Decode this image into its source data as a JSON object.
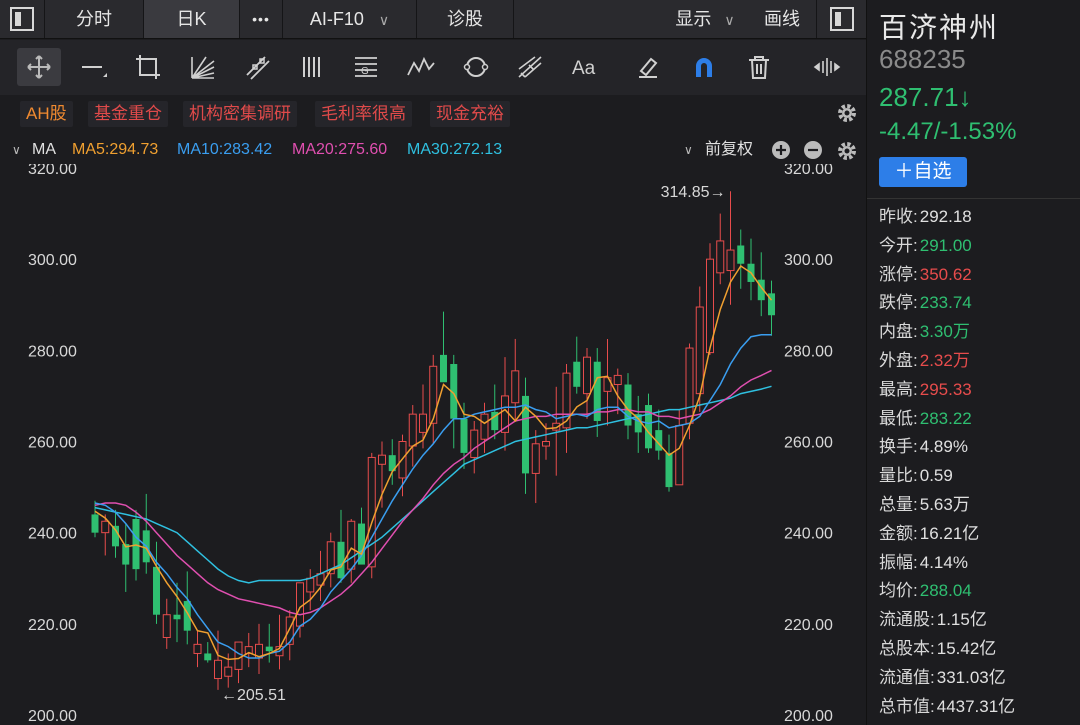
{
  "topbar": {
    "tab_intraday": "分时",
    "tab_daily": "日K",
    "more": "•••",
    "f10": "AI-F10",
    "diagnose": "诊股",
    "display": "显示",
    "draw": "画线"
  },
  "tags": [
    "AH股",
    "基金重仓",
    "机构密集调研",
    "毛利率很高",
    "现金充裕"
  ],
  "ma_bar": {
    "label": "MA",
    "ma5": "MA5:294.73",
    "ma10": "MA10:283.42",
    "ma20": "MA20:275.60",
    "ma30": "MA30:272.13",
    "adjust": "前复权"
  },
  "colors": {
    "up": "#e74c4c",
    "down": "#2fbf71",
    "ma5": "#f0a030",
    "ma10": "#3a9ef0",
    "ma20": "#e04fb0",
    "ma30": "#2fc0e0",
    "accent": "#2d7ee8"
  },
  "icons": [
    "crosshair-icon",
    "line-icon",
    "rect-icon",
    "fan-icon",
    "channel-icon",
    "bars-icon",
    "fib-icon",
    "wave-icon",
    "cycle-icon",
    "gann-icon",
    "text-icon",
    "eraser-icon",
    "magnet-icon",
    "trash-icon",
    "expand-icon"
  ],
  "stock": {
    "name": "百济神州",
    "code": "688235",
    "price": "287.71↓",
    "change": "-4.47/-1.53%",
    "watch": "＋自选"
  },
  "stats": [
    {
      "label": "昨收:",
      "value": "292.18",
      "color": "white"
    },
    {
      "label": "今开:",
      "value": "291.00",
      "color": "green"
    },
    {
      "label": "涨停:",
      "value": "350.62",
      "color": "red"
    },
    {
      "label": "跌停:",
      "value": "233.74",
      "color": "green"
    },
    {
      "label": "内盘:",
      "value": "3.30万",
      "color": "green"
    },
    {
      "label": "外盘:",
      "value": "2.32万",
      "color": "red"
    },
    {
      "label": "最高:",
      "value": "295.33",
      "color": "red"
    },
    {
      "label": "最低:",
      "value": "283.22",
      "color": "green"
    },
    {
      "label": "换手:",
      "value": "4.89%",
      "color": "white"
    },
    {
      "label": "量比:",
      "value": "0.59",
      "color": "white"
    },
    {
      "label": "总量:",
      "value": "5.63万",
      "color": "white"
    },
    {
      "label": "金额:",
      "value": "16.21亿",
      "color": "white"
    },
    {
      "label": "振幅:",
      "value": "4.14%",
      "color": "white"
    },
    {
      "label": "均价:",
      "value": "288.04",
      "color": "green"
    },
    {
      "label": "流通股:",
      "value": "1.15亿",
      "color": "white"
    },
    {
      "label": "总股本:",
      "value": "15.42亿",
      "color": "white"
    },
    {
      "label": "流通值:",
      "value": "331.03亿",
      "color": "white"
    },
    {
      "label": "总市值:",
      "value": "4437.31亿",
      "color": "white"
    }
  ],
  "chart_data": {
    "type": "candlestick",
    "ylim": [
      200,
      320
    ],
    "y_ticks": [
      "320.00",
      "300.00",
      "280.00",
      "260.00",
      "240.00",
      "220.00",
      "200.00"
    ],
    "y_tick_values": [
      320,
      300,
      280,
      260,
      240,
      220,
      200
    ],
    "high_label": "314.85→",
    "low_label": "←205.51",
    "candles": [
      {
        "o": 244.0,
        "h": 247.0,
        "l": 239.0,
        "c": 240.0
      },
      {
        "o": 240.0,
        "h": 244.0,
        "l": 235.0,
        "c": 242.5
      },
      {
        "o": 241.5,
        "h": 245.0,
        "l": 234.5,
        "c": 237.0
      },
      {
        "o": 237.5,
        "h": 242.0,
        "l": 227.0,
        "c": 233.0
      },
      {
        "o": 243.0,
        "h": 245.0,
        "l": 229.5,
        "c": 232.0
      },
      {
        "o": 240.5,
        "h": 248.5,
        "l": 231.0,
        "c": 233.5
      },
      {
        "o": 232.5,
        "h": 238.0,
        "l": 220.0,
        "c": 222.0
      },
      {
        "o": 217.0,
        "h": 225.5,
        "l": 214.5,
        "c": 222.0
      },
      {
        "o": 222.0,
        "h": 229.0,
        "l": 216.0,
        "c": 221.0
      },
      {
        "o": 225.0,
        "h": 231.5,
        "l": 215.5,
        "c": 218.5
      },
      {
        "o": 213.5,
        "h": 218.5,
        "l": 210.5,
        "c": 215.5
      },
      {
        "o": 213.5,
        "h": 216.0,
        "l": 211.5,
        "c": 212.0
      },
      {
        "o": 208.0,
        "h": 218.5,
        "l": 205.5,
        "c": 212.0
      },
      {
        "o": 208.5,
        "h": 213.5,
        "l": 206.0,
        "c": 210.5
      },
      {
        "o": 210.0,
        "h": 215.5,
        "l": 207.0,
        "c": 216.0
      },
      {
        "o": 213.5,
        "h": 218.0,
        "l": 210.5,
        "c": 215.0
      },
      {
        "o": 212.5,
        "h": 220.0,
        "l": 209.0,
        "c": 215.5
      },
      {
        "o": 215.0,
        "h": 220.0,
        "l": 211.5,
        "c": 214.0
      },
      {
        "o": 213.0,
        "h": 222.0,
        "l": 210.0,
        "c": 215.0
      },
      {
        "o": 215.5,
        "h": 223.0,
        "l": 212.0,
        "c": 221.5
      },
      {
        "o": 219.5,
        "h": 226.5,
        "l": 217.0,
        "c": 229.0
      },
      {
        "o": 227.0,
        "h": 232.0,
        "l": 223.0,
        "c": 230.0
      },
      {
        "o": 228.5,
        "h": 236.0,
        "l": 225.0,
        "c": 231.0
      },
      {
        "o": 231.0,
        "h": 240.0,
        "l": 228.0,
        "c": 238.0
      },
      {
        "o": 238.0,
        "h": 245.0,
        "l": 229.0,
        "c": 230.0
      },
      {
        "o": 232.0,
        "h": 243.0,
        "l": 229.0,
        "c": 242.5
      },
      {
        "o": 242.0,
        "h": 245.5,
        "l": 235.0,
        "c": 233.0
      },
      {
        "o": 232.5,
        "h": 257.5,
        "l": 230.0,
        "c": 256.5
      },
      {
        "o": 255.0,
        "h": 260.0,
        "l": 245.5,
        "c": 257.0
      },
      {
        "o": 257.0,
        "h": 260.5,
        "l": 250.5,
        "c": 253.5
      },
      {
        "o": 252.0,
        "h": 261.5,
        "l": 248.0,
        "c": 260.0
      },
      {
        "o": 259.0,
        "h": 268.0,
        "l": 254.5,
        "c": 266.0
      },
      {
        "o": 262.0,
        "h": 272.5,
        "l": 258.5,
        "c": 266.0
      },
      {
        "o": 264.0,
        "h": 279.0,
        "l": 259.5,
        "c": 276.5
      },
      {
        "o": 279.0,
        "h": 288.5,
        "l": 273.5,
        "c": 273.0
      },
      {
        "o": 277.0,
        "h": 279.0,
        "l": 258.5,
        "c": 265.0
      },
      {
        "o": 265.0,
        "h": 268.5,
        "l": 254.0,
        "c": 257.5
      },
      {
        "o": 256.5,
        "h": 264.5,
        "l": 253.0,
        "c": 262.5
      },
      {
        "o": 260.5,
        "h": 268.5,
        "l": 257.5,
        "c": 266.0
      },
      {
        "o": 266.5,
        "h": 272.5,
        "l": 260.5,
        "c": 262.5
      },
      {
        "o": 262.0,
        "h": 278.5,
        "l": 258.0,
        "c": 270.0
      },
      {
        "o": 268.5,
        "h": 282.5,
        "l": 264.5,
        "c": 275.5
      },
      {
        "o": 270.0,
        "h": 274.0,
        "l": 248.5,
        "c": 253.0
      },
      {
        "o": 253.0,
        "h": 262.5,
        "l": 246.5,
        "c": 259.5
      },
      {
        "o": 259.0,
        "h": 264.0,
        "l": 256.0,
        "c": 260.0
      },
      {
        "o": 262.5,
        "h": 272.0,
        "l": 252.5,
        "c": 264.0
      },
      {
        "o": 263.0,
        "h": 277.0,
        "l": 257.5,
        "c": 275.0
      },
      {
        "o": 277.5,
        "h": 283.0,
        "l": 270.5,
        "c": 272.0
      },
      {
        "o": 270.5,
        "h": 280.5,
        "l": 265.0,
        "c": 278.5
      },
      {
        "o": 277.5,
        "h": 280.5,
        "l": 261.0,
        "c": 264.5
      },
      {
        "o": 271.0,
        "h": 282.5,
        "l": 263.5,
        "c": 274.0
      },
      {
        "o": 272.5,
        "h": 276.0,
        "l": 266.0,
        "c": 274.5
      },
      {
        "o": 272.5,
        "h": 275.0,
        "l": 260.5,
        "c": 263.5
      },
      {
        "o": 266.0,
        "h": 270.0,
        "l": 257.5,
        "c": 262.0
      },
      {
        "o": 268.0,
        "h": 270.5,
        "l": 257.5,
        "c": 258.5
      },
      {
        "o": 262.5,
        "h": 267.0,
        "l": 256.0,
        "c": 258.0
      },
      {
        "o": 257.5,
        "h": 261.5,
        "l": 249.0,
        "c": 250.0
      },
      {
        "o": 250.5,
        "h": 267.0,
        "l": 250.5,
        "c": 263.5
      },
      {
        "o": 264.0,
        "h": 281.5,
        "l": 260.5,
        "c": 280.5
      },
      {
        "o": 270.5,
        "h": 294.0,
        "l": 266.5,
        "c": 289.5
      },
      {
        "o": 279.5,
        "h": 303.5,
        "l": 279.0,
        "c": 300.0
      },
      {
        "o": 297.0,
        "h": 310.0,
        "l": 294.5,
        "c": 304.0
      },
      {
        "o": 297.5,
        "h": 314.9,
        "l": 290.0,
        "c": 302.0
      },
      {
        "o": 303.0,
        "h": 306.5,
        "l": 293.5,
        "c": 299.0
      },
      {
        "o": 299.0,
        "h": 304.5,
        "l": 291.0,
        "c": 295.0
      },
      {
        "o": 295.5,
        "h": 301.5,
        "l": 287.5,
        "c": 291.0
      },
      {
        "o": 292.5,
        "h": 295.3,
        "l": 283.2,
        "c": 287.7
      }
    ],
    "ma5": [
      244.7,
      243.2,
      240.6,
      236.9,
      237.3,
      236.6,
      232.6,
      229.0,
      226.0,
      222.4,
      218.5,
      218.0,
      213.1,
      212.2,
      212.4,
      213.7,
      212.8,
      213.5,
      214.6,
      219.0,
      223.6,
      225.3,
      228.0,
      231.8,
      232.5,
      236.6,
      235.3,
      242.2,
      248.4,
      253.4,
      256.2,
      259.0,
      260.3,
      265.0,
      272.5,
      270.5,
      266.0,
      265.5,
      264.0,
      265.5,
      267.0,
      264.5,
      267.5,
      265.5,
      262.8,
      263.0,
      264.5,
      267.6,
      269.0,
      274.0,
      274.3,
      270.0,
      267.0,
      265.0,
      262.0,
      259.5,
      257.0,
      258.5,
      263.5,
      270.0,
      280.5,
      289.0,
      295.0,
      298.5,
      297.0,
      293.8,
      291.0
    ],
    "ma10": [
      246.5,
      246.0,
      244.5,
      242.0,
      239.0,
      237.0,
      233.5,
      231.0,
      228.0,
      225.5,
      222.0,
      219.0,
      216.0,
      215.0,
      213.5,
      212.5,
      212.5,
      213.5,
      214.0,
      216.0,
      219.5,
      221.0,
      223.5,
      227.0,
      229.5,
      232.0,
      235.0,
      239.0,
      243.0,
      247.0,
      250.5,
      254.0,
      257.0,
      259.5,
      262.5,
      265.0,
      265.0,
      266.0,
      266.5,
      267.0,
      267.5,
      267.5,
      268.0,
      267.0,
      266.5,
      265.0,
      265.5,
      266.0,
      265.5,
      267.0,
      267.5,
      267.5,
      265.5,
      264.5,
      264.0,
      264.5,
      263.0,
      263.5,
      264.0,
      265.5,
      269.0,
      272.5,
      277.0,
      280.5,
      283.0,
      283.4,
      283.4
    ],
    "ma20": [
      246.0,
      246.5,
      246.5,
      246.0,
      244.5,
      242.5,
      240.0,
      237.5,
      235.0,
      233.0,
      231.0,
      229.0,
      227.5,
      226.5,
      225.5,
      225.0,
      224.5,
      224.0,
      223.5,
      222.5,
      222.0,
      222.5,
      223.5,
      225.0,
      226.5,
      228.5,
      231.0,
      233.5,
      236.5,
      239.5,
      242.5,
      245.0,
      247.5,
      250.5,
      253.0,
      255.0,
      256.5,
      258.5,
      260.0,
      261.5,
      263.0,
      264.5,
      265.0,
      265.5,
      265.5,
      266.0,
      266.0,
      266.0,
      266.0,
      266.5,
      266.5,
      267.0,
      267.0,
      266.5,
      266.5,
      265.5,
      265.5,
      265.0,
      265.5,
      266.0,
      267.0,
      268.5,
      270.0,
      272.0,
      273.5,
      274.5,
      275.6
    ],
    "ma30": [
      245.5,
      245.0,
      244.5,
      244.0,
      243.5,
      243.0,
      242.0,
      241.0,
      240.0,
      238.0,
      236.0,
      234.0,
      232.0,
      230.5,
      229.5,
      229.0,
      229.5,
      229.5,
      229.5,
      229.5,
      229.5,
      230.0,
      231.0,
      232.0,
      233.0,
      234.5,
      236.0,
      237.5,
      239.0,
      241.0,
      243.0,
      245.0,
      247.0,
      249.0,
      251.0,
      253.0,
      255.0,
      256.0,
      257.0,
      258.0,
      259.0,
      260.0,
      260.5,
      261.0,
      261.5,
      262.0,
      262.5,
      263.0,
      263.0,
      263.5,
      264.0,
      264.5,
      265.0,
      265.5,
      266.0,
      266.5,
      267.0,
      267.0,
      267.5,
      268.0,
      268.5,
      269.0,
      269.5,
      270.5,
      271.0,
      271.5,
      272.1
    ]
  }
}
